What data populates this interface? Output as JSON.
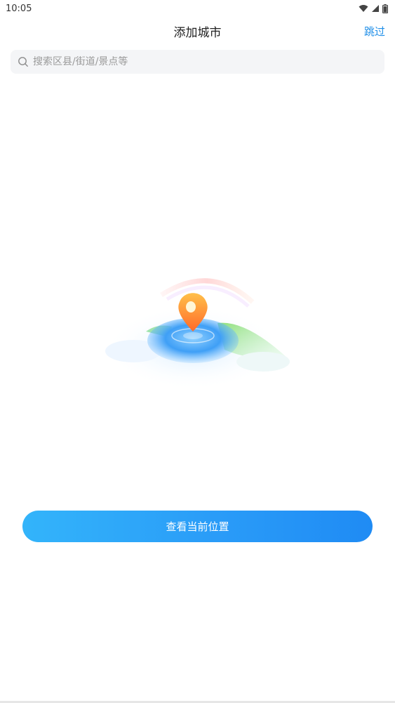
{
  "status_bar": {
    "time": "10:05",
    "icons": [
      "wifi-icon",
      "signal-icon",
      "battery-icon"
    ]
  },
  "nav": {
    "title": "添加城市",
    "skip_label": "跳过"
  },
  "search": {
    "placeholder": "搜索区县/街道/景点等",
    "value": ""
  },
  "illustration": {
    "icon": "location-pin-illustration"
  },
  "action": {
    "locate_label": "查看当前位置"
  },
  "colors": {
    "accent": "#1e8ee8",
    "button_start": "#33b4fa",
    "button_end": "#1f8bf4",
    "search_bg": "#f4f5f7"
  }
}
